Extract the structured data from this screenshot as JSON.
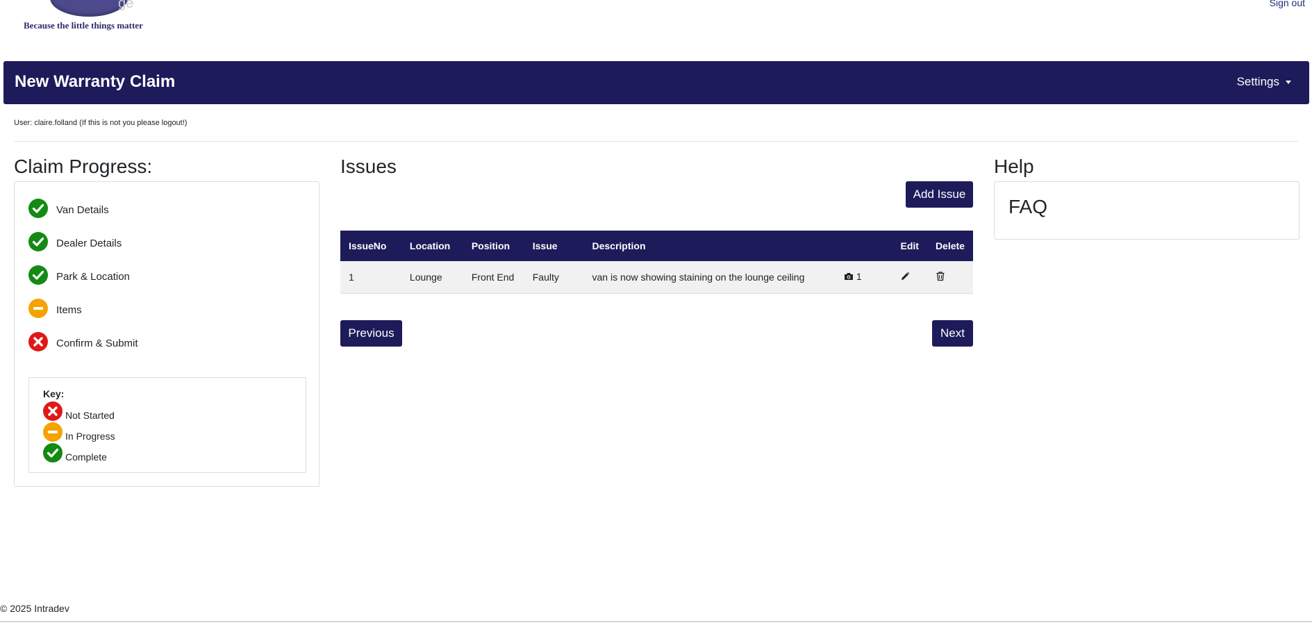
{
  "header": {
    "logo_ghost_text": "ge",
    "tagline": "Because the little things matter",
    "sign_out": "Sign out"
  },
  "navbar": {
    "title": "New Warranty Claim",
    "settings": "Settings"
  },
  "user_line": "User: claire.folland (If this is not you please logout!)",
  "progress": {
    "heading": "Claim Progress:",
    "steps": [
      {
        "label": "Van Details",
        "status": "complete"
      },
      {
        "label": "Dealer Details",
        "status": "complete"
      },
      {
        "label": "Park & Location",
        "status": "complete"
      },
      {
        "label": "Items",
        "status": "in-progress"
      },
      {
        "label": "Confirm & Submit",
        "status": "not-started"
      }
    ],
    "key": {
      "title": "Key:",
      "not_started": "Not Started",
      "in_progress": "In Progress",
      "complete": "Complete"
    }
  },
  "issues": {
    "heading": "Issues",
    "add_button": "Add Issue",
    "columns": [
      "IssueNo",
      "Location",
      "Position",
      "Issue",
      "Description",
      "",
      "Edit",
      "Delete"
    ],
    "rows": [
      {
        "issue_no": "1",
        "location": "Lounge",
        "position": "Front End",
        "issue": "Faulty",
        "description": "van is now showing staining on the lounge ceiling",
        "photo_count": "1"
      }
    ],
    "previous_button": "Previous",
    "next_button": "Next"
  },
  "help": {
    "heading": "Help",
    "faq": "FAQ"
  },
  "footer": "© 2025 Intradev",
  "colors": {
    "brand_navy": "#1d1b5a",
    "complete": "#138a13",
    "in_progress": "#f4a300",
    "not_started": "#e01818"
  },
  "icons": {
    "complete": "check-circle-icon",
    "in_progress": "minus-circle-icon",
    "not_started": "x-circle-icon",
    "photo": "camera-icon",
    "edit": "pencil-icon",
    "delete": "trash-icon"
  }
}
